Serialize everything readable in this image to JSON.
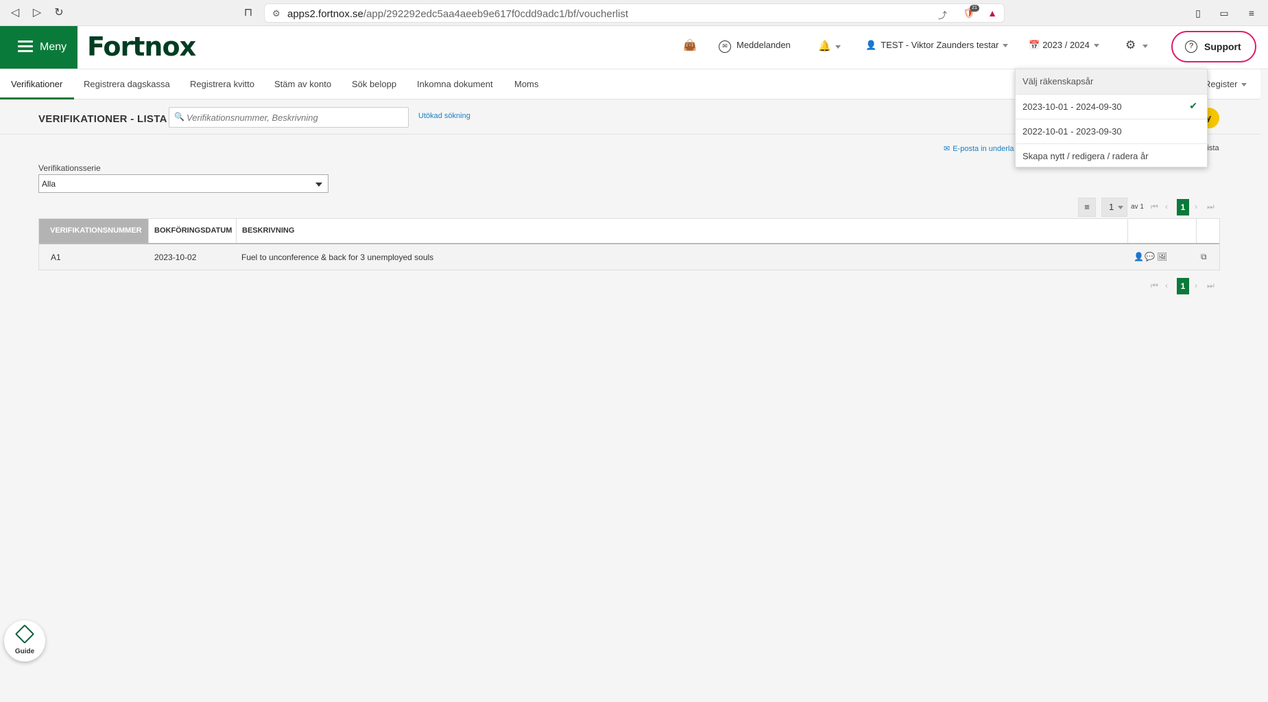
{
  "browser": {
    "url_host": "apps2.fortnox.se",
    "url_path": "/app/292292edc5aa4aeeb9e617f0cdd9adc1/bf/voucherlist",
    "ext_badge": "21"
  },
  "header": {
    "menu_label": "Meny",
    "logo_text": "Fortnox",
    "messages_label": "Meddelanden",
    "user_label": "TEST - Viktor Zaunders testar",
    "year_label": "2023 / 2024",
    "support_label": "Support"
  },
  "tabs": [
    {
      "label": "Verifikationer",
      "active": true
    },
    {
      "label": "Registrera dagskassa"
    },
    {
      "label": "Registrera kvitto"
    },
    {
      "label": "Stäm av konto"
    },
    {
      "label": "Sök belopp"
    },
    {
      "label": "Inkomna dokument"
    },
    {
      "label": "Moms"
    }
  ],
  "register_tab": "Register",
  "page": {
    "title": "VERIFIKATIONER - LISTA",
    "search_placeholder": "Verifikationsnummer, Beskrivning",
    "advanced_search": "Utökad sökning",
    "new_button": "y",
    "email_link": "E-posta in underla",
    "list_link": "lista",
    "serie_label": "Verifikationsserie",
    "serie_value": "Alla"
  },
  "pager": {
    "per_page": "1",
    "of_label": "av 1",
    "current": "1"
  },
  "table": {
    "columns": [
      "VERIFIKATIONSNUMMER",
      "BOKFÖRINGSDATUM",
      "BESKRIVNING"
    ],
    "rows": [
      {
        "number": "A1",
        "date": "2023-10-02",
        "description": "Fuel to unconference & back for 3 unemployed souls"
      }
    ]
  },
  "fiscal_dropdown": {
    "heading": "Välj räkenskapsår",
    "items": [
      {
        "label": "2023-10-01 - 2024-09-30",
        "selected": true
      },
      {
        "label": "2022-10-01 - 2023-09-30"
      },
      {
        "label": "Skapa nytt / redigera / radera år"
      }
    ]
  },
  "guide_label": "Guide",
  "colors": {
    "brand_green": "#0a7a3a",
    "support_border": "#e01e6c",
    "new_button": "#f7c600",
    "link_blue": "#1a7fc1"
  }
}
